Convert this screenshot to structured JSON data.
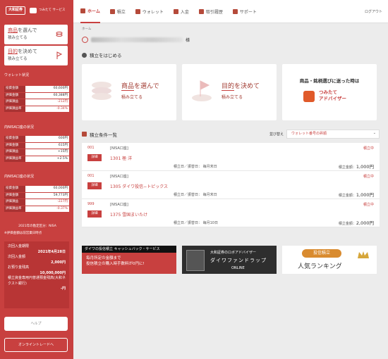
{
  "sidebar": {
    "logo_brand": "大和証券",
    "logo_service": "つみたて\nサービス",
    "card1": {
      "emph": "商品",
      "rest": "を選んで",
      "sub": "積み立てる"
    },
    "card2": {
      "emph": "目的",
      "rest": "を決めて",
      "sub": "積み立てる"
    },
    "status_title": "ウォレット状況",
    "status": [
      {
        "k": "投資金額",
        "v": "60,600円"
      },
      {
        "k": "評価金額",
        "v": "60,388円"
      },
      {
        "k": "評価損益",
        "v": "-212円",
        "neg": true
      },
      {
        "k": "評価損益率",
        "v": "-0.34%",
        "neg": true
      }
    ],
    "inner_title": "内NISA口座の状況",
    "inner": [
      {
        "k": "投資金額",
        "v": "600円"
      },
      {
        "k": "評価金額",
        "v": "615円"
      },
      {
        "k": "評価損益",
        "v": "+15円"
      },
      {
        "k": "評価損益率",
        "v": "+2.5%"
      }
    ],
    "nisa_title": "内NISA口座の状況",
    "nisa": [
      {
        "k": "投資金額",
        "v": "60,000円"
      },
      {
        "k": "評価金額",
        "v": "59,773円"
      },
      {
        "k": "評価損益",
        "v": "-227円",
        "neg": true
      },
      {
        "k": "評価損益率",
        "v": "-0.37%",
        "neg": true
      }
    ],
    "note1": "2021年の勘定区分：NISA",
    "note2": "※評価金額は前営業日時点",
    "info_label1": "次回入金期限",
    "info_val1": "2021年4月28日",
    "info_label2": "次回入金額",
    "info_val2": "2,000円",
    "info_label3": "お預り金残高",
    "info_val3": "10,000,000円",
    "info_label4": "積立資金専用円普通預金残高(大和ネクスト銀行)",
    "info_val4": "-円",
    "help_label": "ヘルプ",
    "trade_label": "オンライントレードへ"
  },
  "header": {
    "nav": [
      {
        "label": "ホーム",
        "icon": "home-icon",
        "active": true
      },
      {
        "label": "積立",
        "icon": "bar-chart-icon"
      },
      {
        "label": "ウォレット",
        "icon": "wallet-icon"
      },
      {
        "label": "入金",
        "icon": "yen-icon"
      },
      {
        "label": "取引履歴",
        "icon": "history-icon"
      },
      {
        "label": "サポート",
        "icon": "book-icon"
      }
    ],
    "logout": "ログアウト"
  },
  "main": {
    "breadcrumb": "ホーム",
    "user_suffix": "様",
    "start_title": "積立をはじめる",
    "card_a": {
      "emph": "商品",
      "rest": "を選んで",
      "sub": "積み立てる"
    },
    "card_b": {
      "emph": "目的",
      "rest": "を決めて",
      "sub": "積み立てる"
    },
    "card_c": {
      "title": "商品・銘柄選びに迷った時は",
      "name1": "つみたて",
      "name2": "アドバイザー"
    },
    "list_title": "積立条件一覧",
    "sort_label": "並び替え",
    "sort_value": "ウォレット番号の昇順",
    "rows": [
      {
        "num": "001",
        "badge": "詳細",
        "acct": "[NISA口座]",
        "fund": "1301 極 洋",
        "status": "積立中",
        "date": "積立日／振替日： 毎月末日",
        "amt_label": "積立金額：",
        "amt": "1,000円"
      },
      {
        "num": "001",
        "badge": "詳細",
        "acct": "[NISA口座]",
        "fund": "1305 ダイワ投信−トピックス",
        "status": "積立中",
        "date": "積立日／振替日： 毎月末日",
        "amt_label": "積立金額：",
        "amt": "1,000円"
      },
      {
        "num": "999",
        "badge": "詳細",
        "acct": "[NISA口座]",
        "fund": "1375 雪国まいたけ",
        "status": "積立中",
        "date": "積立日／振替日： 毎月10日",
        "amt_label": "積立金額：",
        "amt": "2,000円"
      }
    ],
    "banner1": {
      "top": "ダイワの投信積立 キャッシュバック・サービス",
      "l1": "毎月所定の金額まで",
      "l2": "投信積立の購入時手数料が0円に!"
    },
    "banner2": {
      "l1": "大和証券のロボアドバイザー",
      "l2": "ダイワファンドラップ",
      "l3": "ONLINE"
    },
    "banner3": {
      "pill": "投信積立",
      "txt": "人気ランキング"
    }
  }
}
